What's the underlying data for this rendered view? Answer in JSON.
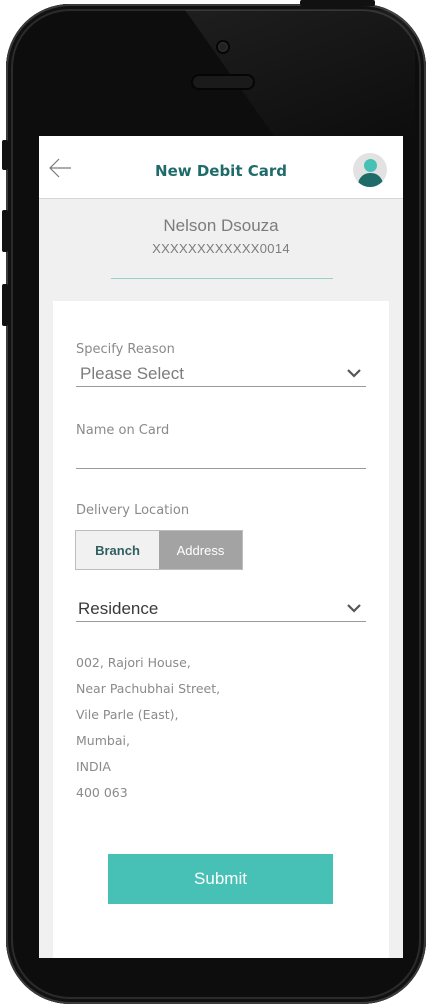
{
  "header": {
    "title": "New Debit Card"
  },
  "account": {
    "name": "Nelson Dsouza",
    "number": "XXXXXXXXXXXX0014"
  },
  "form": {
    "reason_label": "Specify Reason",
    "reason_value": "Please Select",
    "name_label": "Name on Card",
    "name_value": "",
    "delivery_label": "Delivery Location",
    "delivery_options": [
      "Branch",
      "Address"
    ],
    "delivery_selected": "Address",
    "address_type": "Residence",
    "address_lines": [
      "002, Rajori House,",
      "Near Pachubhai Street,",
      "Vile Parle (East),",
      "Mumbai,",
      "INDIA",
      "400 063"
    ],
    "submit_label": "Submit"
  },
  "colors": {
    "accent": "#47c1b6",
    "title": "#1f6b6a",
    "segment_selected": "#a3a3a3"
  },
  "icons": {
    "back": "back-arrow-icon",
    "avatar": "user-avatar-icon",
    "dropdown": "chevron-down-icon"
  }
}
